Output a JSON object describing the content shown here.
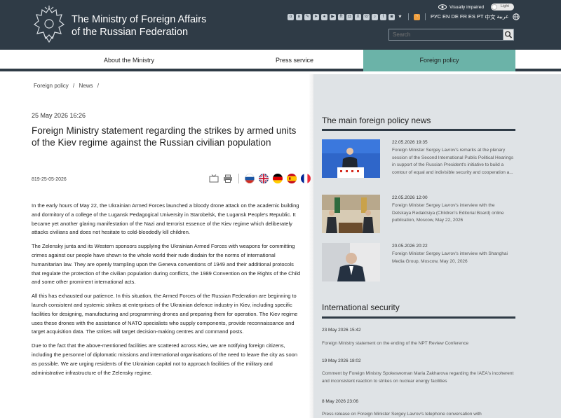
{
  "header": {
    "title_line1": "The Ministry of Foreign Affairs",
    "title_line2": "of the Russian Federation",
    "visually_impaired": "Visually impaired",
    "toggle_label": "Light",
    "languages": [
      "РУС",
      "EN",
      "DE",
      "FR",
      "ES",
      "PT",
      "中文",
      "عربية"
    ],
    "search_placeholder": "Search",
    "social_icons": [
      "ok-icon",
      "vk-icon",
      "livejournal-icon",
      "telegram-icon",
      "flickr-icon",
      "youtube-icon",
      "rutube-icon",
      "instagram-icon",
      "twitter-icon",
      "viber-icon",
      "podcast-icon",
      "facebook-icon",
      "instagram-alt-icon",
      "star-icon"
    ],
    "colors": {
      "bg": "#2f3b46",
      "accent": "#6bb3a8"
    }
  },
  "nav": {
    "items": [
      {
        "label": "About the Ministry"
      },
      {
        "label": "Press service"
      },
      {
        "label": "Foreign policy"
      }
    ]
  },
  "breadcrumb": [
    "Foreign policy",
    "/",
    "News",
    "/"
  ],
  "article": {
    "date": "25 May 2026 16:26",
    "title": "Foreign Ministry statement regarding the strikes by armed units of the Kiev regime against the Russian civilian population",
    "number": "819-25-05-2026",
    "paragraphs": [
      "In the early hours of May 22, the Ukrainian Armed Forces launched a bloody drone attack on the academic building and dormitory of a college of the Lugansk Pedagogical University in Starobelsk, the Lugansk People's Republic. It became yet another glaring manifestation of the Nazi and terrorist essence of the Kiev regime which deliberately attacks civilians and does not hesitate to cold-bloodedly kill children.",
      "The Zelensky junta and its Western sponsors supplying the Ukrainian Armed Forces with weapons for committing crimes against our people have shown to the whole world their rude disdain for the norms of international humanitarian law. They are openly trampling upon the Geneva conventions of 1949 and their additional protocols that regulate the protection of the civilian population during conflicts, the 1989 Convention on the Rights of the Child and some other prominent international acts.",
      "All this has exhausted our patience. In this situation, the Armed Forces of the Russian Federation are beginning to launch consistent and systemic strikes at enterprises of the Ukrainian defence industry in Kiev, including specific facilities for designing, manufacturing and programming drones and preparing them for operation. The Kiev regime uses these drones with the assistance of NATO specialists who supply components, provide reconnaissance and target acquisition data. The strikes will target decision-making centres and command posts.",
      "Due to the fact that the above-mentioned facilities are scattered across Kiev, we are notifying foreign citizens, including the personnel of diplomatic missions and international organisations of the need to leave the city as soon as possible. We are urging residents of the Ukrainian capital not to approach facilities of the military and administrative infrastructure of the Zelensky regime."
    ]
  },
  "sidebar": {
    "main_news_heading": "The main foreign policy news",
    "main_news": [
      {
        "date": "22.05.2026 19:35",
        "text": "Foreign Minister Sergey Lavrov's remarks at the plenary session of the Second International Public Political Hearings in support of the Russian President's initiative to build a contour of equal and indivisible security and cooperation a..."
      },
      {
        "date": "22.05.2026 12:00",
        "text": "Foreign Minister Sergey Lavrov's interview with the Detskaya Redaktsiya (Children's Editorial Board) online publication, Moscow, May 22, 2026"
      },
      {
        "date": "20.05.2026 20:22",
        "text": "Foreign Minister Sergey Lavrov's interview with Shanghai Media Group, Moscow, May 20, 2026"
      }
    ],
    "security_heading": "International security",
    "security_news": [
      {
        "date": "23 May 2026 15:42",
        "text": "Foreign Ministry statement on the ending of the NPT Review Conference"
      },
      {
        "date": "19 May 2026 18:02",
        "text": "Comment by Foreign Ministry Spokeswoman Maria Zakharova regarding the IAEA's incoherent and inconsistent reaction to strikes on nuclear energy facilities"
      },
      {
        "date": "8 May 2026 23:06",
        "text": "Press release on Foreign Minister Sergey Lavrov's telephone conversation with"
      }
    ]
  }
}
